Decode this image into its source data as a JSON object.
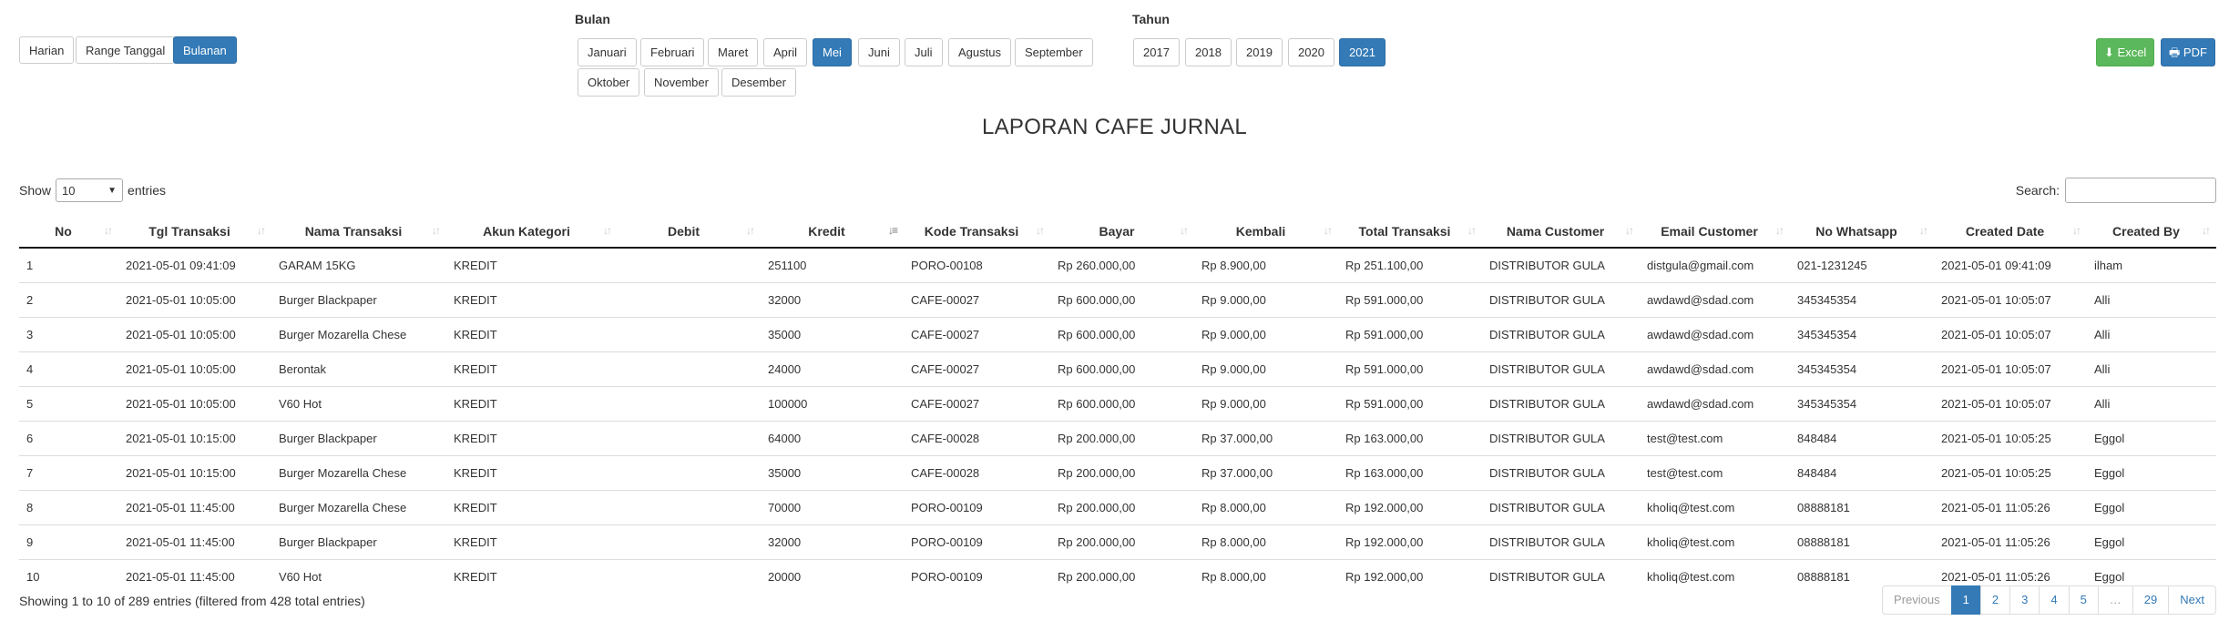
{
  "filters": {
    "mode_buttons": [
      "Harian",
      "Range Tanggal",
      "Bulanan"
    ],
    "active_mode": "Bulanan",
    "bulan_label": "Bulan",
    "months": [
      "Januari",
      "Februari",
      "Maret",
      "April",
      "Mei",
      "Juni",
      "Juli",
      "Agustus",
      "September",
      "Oktober",
      "November",
      "Desember"
    ],
    "active_month": "Mei",
    "tahun_label": "Tahun",
    "years": [
      "2017",
      "2018",
      "2019",
      "2020",
      "2021"
    ],
    "active_year": "2021"
  },
  "export": {
    "excel_label": "Excel",
    "pdf_label": "PDF",
    "excel_color": "#5cb85c",
    "pdf_color": "#337ab7",
    "excel_icon": "download-icon",
    "pdf_icon": "print-icon"
  },
  "report_title": "LAPORAN CAFE JURNAL",
  "length_control": {
    "show": "Show",
    "value": "10",
    "entries": "entries"
  },
  "search": {
    "label": "Search:",
    "value": ""
  },
  "table": {
    "sorted_column": "Kredit",
    "columns": [
      "No",
      "Tgl Transaksi",
      "Nama Transaksi",
      "Akun Kategori",
      "Debit",
      "Kredit",
      "Kode Transaksi",
      "Bayar",
      "Kembali",
      "Total Transaksi",
      "Nama Customer",
      "Email Customer",
      "No Whatsapp",
      "Created Date",
      "Created By"
    ],
    "rows": [
      [
        "1",
        "2021-05-01 09:41:09",
        "GARAM 15KG",
        "KREDIT",
        "",
        "251100",
        "PORO-00108",
        "Rp 260.000,00",
        "Rp 8.900,00",
        "Rp 251.100,00",
        "DISTRIBUTOR GULA",
        "distgula@gmail.com",
        "021-1231245",
        "2021-05-01 09:41:09",
        "ilham"
      ],
      [
        "2",
        "2021-05-01 10:05:00",
        "Burger Blackpaper",
        "KREDIT",
        "",
        "32000",
        "CAFE-00027",
        "Rp 600.000,00",
        "Rp 9.000,00",
        "Rp 591.000,00",
        "DISTRIBUTOR GULA",
        "awdawd@sdad.com",
        "345345354",
        "2021-05-01 10:05:07",
        "Alli"
      ],
      [
        "3",
        "2021-05-01 10:05:00",
        "Burger Mozarella Chese",
        "KREDIT",
        "",
        "35000",
        "CAFE-00027",
        "Rp 600.000,00",
        "Rp 9.000,00",
        "Rp 591.000,00",
        "DISTRIBUTOR GULA",
        "awdawd@sdad.com",
        "345345354",
        "2021-05-01 10:05:07",
        "Alli"
      ],
      [
        "4",
        "2021-05-01 10:05:00",
        "Berontak",
        "KREDIT",
        "",
        "24000",
        "CAFE-00027",
        "Rp 600.000,00",
        "Rp 9.000,00",
        "Rp 591.000,00",
        "DISTRIBUTOR GULA",
        "awdawd@sdad.com",
        "345345354",
        "2021-05-01 10:05:07",
        "Alli"
      ],
      [
        "5",
        "2021-05-01 10:05:00",
        "V60 Hot",
        "KREDIT",
        "",
        "100000",
        "CAFE-00027",
        "Rp 600.000,00",
        "Rp 9.000,00",
        "Rp 591.000,00",
        "DISTRIBUTOR GULA",
        "awdawd@sdad.com",
        "345345354",
        "2021-05-01 10:05:07",
        "Alli"
      ],
      [
        "6",
        "2021-05-01 10:15:00",
        "Burger Blackpaper",
        "KREDIT",
        "",
        "64000",
        "CAFE-00028",
        "Rp 200.000,00",
        "Rp 37.000,00",
        "Rp 163.000,00",
        "DISTRIBUTOR GULA",
        "test@test.com",
        "848484",
        "2021-05-01 10:05:25",
        "Eggol"
      ],
      [
        "7",
        "2021-05-01 10:15:00",
        "Burger Mozarella Chese",
        "KREDIT",
        "",
        "35000",
        "CAFE-00028",
        "Rp 200.000,00",
        "Rp 37.000,00",
        "Rp 163.000,00",
        "DISTRIBUTOR GULA",
        "test@test.com",
        "848484",
        "2021-05-01 10:05:25",
        "Eggol"
      ],
      [
        "8",
        "2021-05-01 11:45:00",
        "Burger Mozarella Chese",
        "KREDIT",
        "",
        "70000",
        "PORO-00109",
        "Rp 200.000,00",
        "Rp 8.000,00",
        "Rp 192.000,00",
        "DISTRIBUTOR GULA",
        "kholiq@test.com",
        "08888181",
        "2021-05-01 11:05:26",
        "Eggol"
      ],
      [
        "9",
        "2021-05-01 11:45:00",
        "Burger Blackpaper",
        "KREDIT",
        "",
        "32000",
        "PORO-00109",
        "Rp 200.000,00",
        "Rp 8.000,00",
        "Rp 192.000,00",
        "DISTRIBUTOR GULA",
        "kholiq@test.com",
        "08888181",
        "2021-05-01 11:05:26",
        "Eggol"
      ],
      [
        "10",
        "2021-05-01 11:45:00",
        "V60 Hot",
        "KREDIT",
        "",
        "20000",
        "PORO-00109",
        "Rp 200.000,00",
        "Rp 8.000,00",
        "Rp 192.000,00",
        "DISTRIBUTOR GULA",
        "kholiq@test.com",
        "08888181",
        "2021-05-01 11:05:26",
        "Eggol"
      ]
    ]
  },
  "info_text": "Showing 1 to 10 of 289 entries (filtered from 428 total entries)",
  "pagination": {
    "previous": "Previous",
    "pages": [
      "1",
      "2",
      "3",
      "4",
      "5",
      "…",
      "29"
    ],
    "current": "1",
    "next": "Next"
  }
}
